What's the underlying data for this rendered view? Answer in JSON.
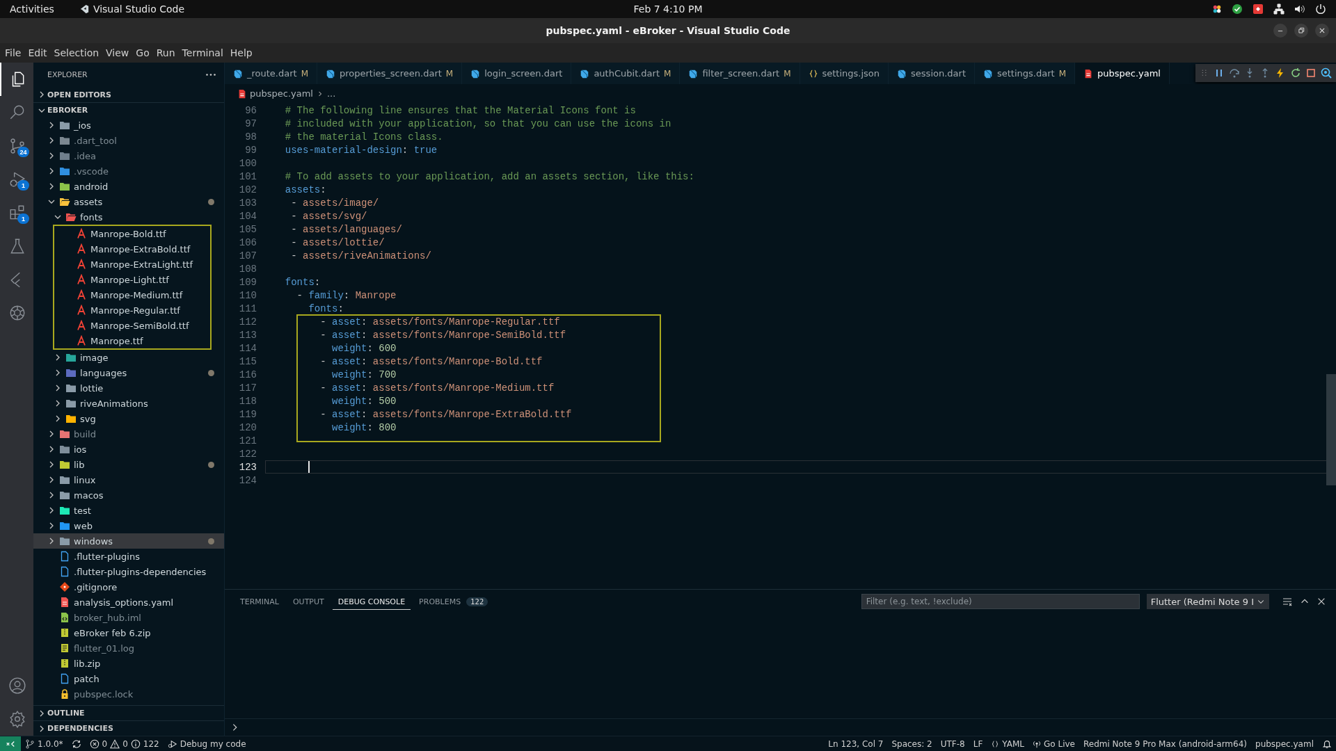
{
  "top_bar": {
    "activities": "Activities",
    "app_name": "Visual Studio Code",
    "clock": "Feb 7  4:10 PM"
  },
  "window": {
    "title": "pubspec.yaml - eBroker - Visual Studio Code"
  },
  "menu": [
    "File",
    "Edit",
    "Selection",
    "View",
    "Go",
    "Run",
    "Terminal",
    "Help"
  ],
  "activity_bar": {
    "items": [
      {
        "kind": "explorer",
        "selected": true
      },
      {
        "kind": "search",
        "selected": false
      },
      {
        "kind": "source-control",
        "selected": false,
        "badge": "24"
      },
      {
        "kind": "run-debug",
        "selected": false,
        "badge": "1"
      },
      {
        "kind": "extensions",
        "selected": false,
        "badge": "1"
      },
      {
        "kind": "testing",
        "selected": false
      },
      {
        "kind": "flutter",
        "selected": false
      },
      {
        "kind": "knot",
        "selected": false
      }
    ],
    "bottom": [
      {
        "kind": "account",
        "selected": false
      },
      {
        "kind": "settings",
        "selected": false
      }
    ]
  },
  "sidebar": {
    "title": "EXPLORER",
    "sections": [
      {
        "label": "OPEN EDITORS",
        "expanded": false
      },
      {
        "label": "EBROKER",
        "expanded": true,
        "tree": [
          {
            "label": "_ios",
            "kind": "folder",
            "color": "#8a9ba8",
            "expanded": false,
            "modified": false,
            "dimmed": false,
            "selected": false
          },
          {
            "label": ".dart_tool",
            "kind": "folder",
            "color": "#7b8790",
            "expanded": false,
            "modified": false,
            "dimmed": true,
            "selected": false
          },
          {
            "label": ".idea",
            "kind": "folder",
            "color": "#6f7f8c",
            "expanded": false,
            "modified": false,
            "dimmed": true,
            "selected": false
          },
          {
            "label": ".vscode",
            "kind": "folder",
            "color": "#2f8fe0",
            "expanded": false,
            "modified": false,
            "dimmed": true,
            "selected": false
          },
          {
            "label": "android",
            "kind": "folder",
            "color": "#8bc34a",
            "expanded": false,
            "modified": false,
            "dimmed": false,
            "selected": false
          },
          {
            "label": "assets",
            "kind": "folder",
            "color": "#f9c23c",
            "expanded": true,
            "modified": true,
            "dimmed": false,
            "selected": false,
            "children": [
              {
                "label": "fonts",
                "kind": "folder",
                "color": "#ef5350",
                "expanded": true,
                "boxed": true,
                "modified": false,
                "dimmed": false,
                "selected": false,
                "children": [
                  {
                    "label": "Manrope-Bold.ttf",
                    "kind": "font",
                    "color": "#f44336",
                    "modified": false,
                    "dimmed": false,
                    "selected": false
                  },
                  {
                    "label": "Manrope-ExtraBold.ttf",
                    "kind": "font",
                    "color": "#f44336",
                    "modified": false,
                    "dimmed": false,
                    "selected": false
                  },
                  {
                    "label": "Manrope-ExtraLight.ttf",
                    "kind": "font",
                    "color": "#f44336",
                    "modified": false,
                    "dimmed": false,
                    "selected": false
                  },
                  {
                    "label": "Manrope-Light.ttf",
                    "kind": "font",
                    "color": "#f44336",
                    "modified": false,
                    "dimmed": false,
                    "selected": false
                  },
                  {
                    "label": "Manrope-Medium.ttf",
                    "kind": "font",
                    "color": "#f44336",
                    "modified": false,
                    "dimmed": false,
                    "selected": false
                  },
                  {
                    "label": "Manrope-Regular.ttf",
                    "kind": "font",
                    "color": "#f44336",
                    "modified": false,
                    "dimmed": false,
                    "selected": false
                  },
                  {
                    "label": "Manrope-SemiBold.ttf",
                    "kind": "font",
                    "color": "#f44336",
                    "modified": false,
                    "dimmed": false,
                    "selected": false
                  },
                  {
                    "label": "Manrope.ttf",
                    "kind": "font",
                    "color": "#f44336",
                    "modified": false,
                    "dimmed": false,
                    "selected": false
                  }
                ]
              },
              {
                "label": "image",
                "kind": "folder",
                "color": "#26a69a",
                "expanded": false,
                "modified": false,
                "dimmed": false,
                "selected": false
              },
              {
                "label": "languages",
                "kind": "folder",
                "color": "#5c6bc0",
                "expanded": false,
                "modified": true,
                "dimmed": false,
                "selected": false
              },
              {
                "label": "lottie",
                "kind": "folder",
                "color": "#8a9ba8",
                "expanded": false,
                "modified": false,
                "dimmed": false,
                "selected": false
              },
              {
                "label": "riveAnimations",
                "kind": "folder",
                "color": "#8a9ba8",
                "expanded": false,
                "modified": false,
                "dimmed": false,
                "selected": false
              },
              {
                "label": "svg",
                "kind": "folder",
                "color": "#ffb300",
                "expanded": false,
                "modified": false,
                "dimmed": false,
                "selected": false
              }
            ]
          },
          {
            "label": "build",
            "kind": "folder",
            "color": "#e57373",
            "expanded": false,
            "modified": false,
            "dimmed": true,
            "selected": false
          },
          {
            "label": "ios",
            "kind": "folder",
            "color": "#7e8e9a",
            "expanded": false,
            "modified": false,
            "dimmed": false,
            "selected": false
          },
          {
            "label": "lib",
            "kind": "folder",
            "color": "#c0ca33",
            "expanded": false,
            "modified": true,
            "dimmed": false,
            "selected": false
          },
          {
            "label": "linux",
            "kind": "folder",
            "color": "#8a9ba8",
            "expanded": false,
            "modified": false,
            "dimmed": false,
            "selected": false
          },
          {
            "label": "macos",
            "kind": "folder",
            "color": "#8a9ba8",
            "expanded": false,
            "modified": false,
            "dimmed": false,
            "selected": false
          },
          {
            "label": "test",
            "kind": "folder",
            "color": "#1de9b6",
            "expanded": false,
            "modified": false,
            "dimmed": false,
            "selected": false
          },
          {
            "label": "web",
            "kind": "folder",
            "color": "#2196f3",
            "expanded": false,
            "modified": false,
            "dimmed": false,
            "selected": false
          },
          {
            "label": "windows",
            "kind": "folder",
            "color": "#8a9ba8",
            "expanded": false,
            "modified": true,
            "dimmed": false,
            "selected": true
          },
          {
            "label": ".flutter-plugins",
            "kind": "file",
            "color": "#42a5f5",
            "modified": false,
            "dimmed": false,
            "selected": false
          },
          {
            "label": ".flutter-plugins-dependencies",
            "kind": "file",
            "color": "#42a5f5",
            "modified": false,
            "dimmed": false,
            "selected": false
          },
          {
            "label": ".gitignore",
            "kind": "git",
            "color": "#e64a19",
            "modified": false,
            "dimmed": false,
            "selected": false
          },
          {
            "label": "analysis_options.yaml",
            "kind": "yaml",
            "color": "#ef5350",
            "modified": false,
            "dimmed": false,
            "selected": false
          },
          {
            "label": "broker_hub.iml",
            "kind": "xml",
            "color": "#8bc34a",
            "modified": false,
            "dimmed": true,
            "selected": false
          },
          {
            "label": "eBroker feb 6.zip",
            "kind": "zip",
            "color": "#c0ca33",
            "modified": false,
            "dimmed": false,
            "selected": false
          },
          {
            "label": "flutter_01.log",
            "kind": "log",
            "color": "#c0ca33",
            "modified": false,
            "dimmed": true,
            "selected": false
          },
          {
            "label": "lib.zip",
            "kind": "zip",
            "color": "#c0ca33",
            "modified": false,
            "dimmed": false,
            "selected": false
          },
          {
            "label": "patch",
            "kind": "file",
            "color": "#42a5f5",
            "modified": false,
            "dimmed": false,
            "selected": false
          },
          {
            "label": "pubspec.lock",
            "kind": "lock",
            "color": "#fbc02d",
            "modified": false,
            "dimmed": true,
            "selected": false
          }
        ]
      },
      {
        "label": "OUTLINE",
        "expanded": false
      },
      {
        "label": "DEPENDENCIES",
        "expanded": false
      }
    ]
  },
  "tabs": [
    {
      "label": "_route.dart",
      "kind": "dart",
      "badge": "M",
      "selected": false
    },
    {
      "label": "properties_screen.dart",
      "kind": "dart",
      "badge": "M",
      "selected": false
    },
    {
      "label": "login_screen.dart",
      "kind": "dart",
      "selected": false
    },
    {
      "label": "authCubit.dart",
      "kind": "dart",
      "badge": "M",
      "selected": false
    },
    {
      "label": "filter_screen.dart",
      "kind": "dart",
      "badge": "M",
      "selected": false
    },
    {
      "label": "settings.json",
      "kind": "json",
      "selected": false
    },
    {
      "label": "session.dart",
      "kind": "dart",
      "selected": false
    },
    {
      "label": "settings.dart",
      "kind": "dart",
      "badge": "M",
      "selected": false
    },
    {
      "label": "pubspec.yaml",
      "kind": "yaml",
      "selected": true
    }
  ],
  "breadcrumb": [
    "pubspec.yaml",
    "..."
  ],
  "editor": {
    "blocks": [
      {
        "boxed": false,
        "lines": [
          {
            "number": "96",
            "current": false,
            "tokens": [
              {
                "kind": "comment",
                "text": "  # The following line ensures that the Material Icons font is"
              }
            ]
          },
          {
            "number": "97",
            "current": false,
            "tokens": [
              {
                "kind": "comment",
                "text": "  # included with your application, so that you can use the icons in"
              }
            ]
          },
          {
            "number": "98",
            "current": false,
            "tokens": [
              {
                "kind": "comment",
                "text": "  # the material Icons class."
              }
            ]
          },
          {
            "number": "99",
            "current": false,
            "tokens": [
              {
                "kind": "key",
                "text": "  uses-material-design"
              },
              {
                "kind": "plain",
                "text": ": "
              },
              {
                "kind": "bool",
                "text": "true"
              }
            ]
          },
          {
            "number": "100",
            "current": false
          },
          {
            "number": "101",
            "current": false,
            "tokens": [
              {
                "kind": "comment",
                "text": "  # To add assets to your application, add an assets section, like this:"
              }
            ]
          },
          {
            "number": "102",
            "current": false,
            "tokens": [
              {
                "kind": "key",
                "text": "  assets"
              },
              {
                "kind": "plain",
                "text": ":"
              }
            ]
          },
          {
            "number": "103",
            "current": false,
            "tokens": [
              {
                "kind": "plain",
                "text": "   - "
              },
              {
                "kind": "string",
                "text": "assets/image/"
              }
            ]
          },
          {
            "number": "104",
            "current": false,
            "tokens": [
              {
                "kind": "plain",
                "text": "   - "
              },
              {
                "kind": "string",
                "text": "assets/svg/"
              }
            ]
          },
          {
            "number": "105",
            "current": false,
            "tokens": [
              {
                "kind": "plain",
                "text": "   - "
              },
              {
                "kind": "string",
                "text": "assets/languages/"
              }
            ]
          },
          {
            "number": "106",
            "current": false,
            "tokens": [
              {
                "kind": "plain",
                "text": "   - "
              },
              {
                "kind": "string",
                "text": "assets/lottie/"
              }
            ]
          },
          {
            "number": "107",
            "current": false,
            "tokens": [
              {
                "kind": "plain",
                "text": "   - "
              },
              {
                "kind": "string",
                "text": "assets/riveAnimations/"
              }
            ]
          },
          {
            "number": "108",
            "current": false
          },
          {
            "number": "109",
            "current": false,
            "tokens": [
              {
                "kind": "key",
                "text": "  fonts"
              },
              {
                "kind": "plain",
                "text": ":"
              }
            ]
          },
          {
            "number": "110",
            "current": false,
            "tokens": [
              {
                "kind": "plain",
                "text": "    - "
              },
              {
                "kind": "key",
                "text": "family"
              },
              {
                "kind": "plain",
                "text": ": "
              },
              {
                "kind": "string",
                "text": "Manrope"
              }
            ]
          },
          {
            "number": "111",
            "current": false,
            "tokens": [
              {
                "kind": "key",
                "text": "      fonts"
              },
              {
                "kind": "plain",
                "text": ":"
              }
            ]
          }
        ]
      },
      {
        "boxed": true,
        "lines": [
          {
            "number": "112",
            "current": false,
            "tokens": [
              {
                "kind": "plain",
                "text": "        - "
              },
              {
                "kind": "key",
                "text": "asset"
              },
              {
                "kind": "plain",
                "text": ": "
              },
              {
                "kind": "string",
                "text": "assets/fonts/Manrope-Regular.ttf"
              }
            ]
          },
          {
            "number": "113",
            "current": false,
            "tokens": [
              {
                "kind": "plain",
                "text": "        - "
              },
              {
                "kind": "key",
                "text": "asset"
              },
              {
                "kind": "plain",
                "text": ": "
              },
              {
                "kind": "string",
                "text": "assets/fonts/Manrope-SemiBold.ttf"
              }
            ]
          },
          {
            "number": "114",
            "current": false,
            "tokens": [
              {
                "kind": "key",
                "text": "          weight"
              },
              {
                "kind": "plain",
                "text": ": "
              },
              {
                "kind": "number",
                "text": "600"
              }
            ]
          },
          {
            "number": "115",
            "current": false,
            "tokens": [
              {
                "kind": "plain",
                "text": "        - "
              },
              {
                "kind": "key",
                "text": "asset"
              },
              {
                "kind": "plain",
                "text": ": "
              },
              {
                "kind": "string",
                "text": "assets/fonts/Manrope-Bold.ttf"
              }
            ]
          },
          {
            "number": "116",
            "current": false,
            "tokens": [
              {
                "kind": "key",
                "text": "          weight"
              },
              {
                "kind": "plain",
                "text": ": "
              },
              {
                "kind": "number",
                "text": "700"
              }
            ]
          },
          {
            "number": "117",
            "current": false,
            "tokens": [
              {
                "kind": "plain",
                "text": "        - "
              },
              {
                "kind": "key",
                "text": "asset"
              },
              {
                "kind": "plain",
                "text": ": "
              },
              {
                "kind": "string",
                "text": "assets/fonts/Manrope-Medium.ttf"
              }
            ]
          },
          {
            "number": "118",
            "current": false,
            "tokens": [
              {
                "kind": "key",
                "text": "          weight"
              },
              {
                "kind": "plain",
                "text": ": "
              },
              {
                "kind": "number",
                "text": "500"
              }
            ]
          },
          {
            "number": "119",
            "current": false,
            "tokens": [
              {
                "kind": "plain",
                "text": "        - "
              },
              {
                "kind": "key",
                "text": "asset"
              },
              {
                "kind": "plain",
                "text": ": "
              },
              {
                "kind": "string",
                "text": "assets/fonts/Manrope-ExtraBold.ttf"
              }
            ]
          },
          {
            "number": "120",
            "current": false,
            "tokens": [
              {
                "kind": "key",
                "text": "          weight"
              },
              {
                "kind": "plain",
                "text": ": "
              },
              {
                "kind": "number",
                "text": "800"
              }
            ]
          }
        ]
      },
      {
        "boxed": false,
        "lines": [
          {
            "number": "121",
            "current": false
          },
          {
            "number": "122",
            "current": false
          },
          {
            "number": "123",
            "current": true
          },
          {
            "number": "124",
            "current": false
          }
        ]
      }
    ]
  },
  "panel": {
    "tabs": [
      {
        "label": "TERMINAL",
        "selected": false
      },
      {
        "label": "OUTPUT",
        "selected": false
      },
      {
        "label": "DEBUG CONSOLE",
        "selected": true
      },
      {
        "label": "PROBLEMS",
        "count": "122",
        "selected": false
      }
    ],
    "filter": {
      "placeholder": "Filter (e.g. text, !exclude)"
    },
    "target": "Flutter (Redmi Note 9 I"
  },
  "status_bar": {
    "branch": "1.0.0*",
    "errors": "0",
    "warnings": "0",
    "infos": "122",
    "debug": "Debug my code",
    "right": [
      {
        "kind": "text",
        "text": "Ln 123, Col 7"
      },
      {
        "kind": "text",
        "text": "Spaces: 2"
      },
      {
        "kind": "text",
        "text": "UTF-8"
      },
      {
        "kind": "text",
        "text": "LF"
      },
      {
        "kind": "language",
        "text": "YAML"
      },
      {
        "kind": "live",
        "text": "Go Live"
      },
      {
        "kind": "text",
        "text": "Redmi Note 9 Pro Max (android-arm64)"
      },
      {
        "kind": "text",
        "text": "pubspec.yaml"
      },
      {
        "kind": "bell"
      }
    ]
  }
}
